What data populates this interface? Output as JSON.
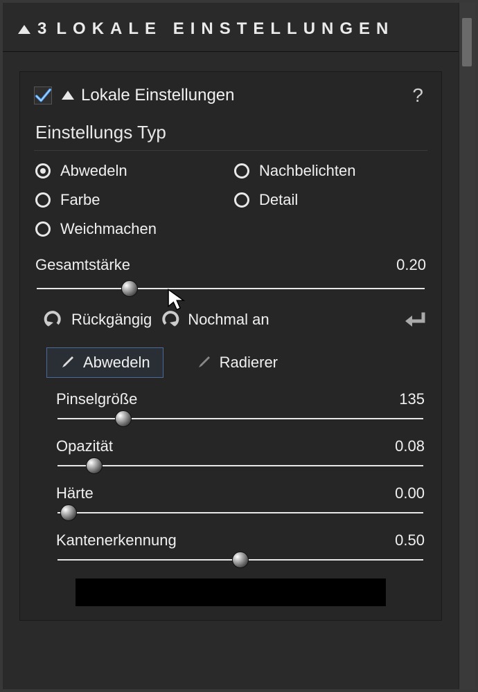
{
  "header": {
    "number": "3",
    "title": "LOKALE EINSTELLUNGEN"
  },
  "panel": {
    "title": "Lokale Einstellungen",
    "help": "?",
    "subheading": "Einstellungs Typ",
    "radios": {
      "dodge": "Abwedeln",
      "burn": "Nachbelichten",
      "color": "Farbe",
      "detail": "Detail",
      "blur": "Weichmachen"
    },
    "overall": {
      "label": "Gesamtstärke",
      "value": "0.20",
      "pos": 24
    },
    "actions": {
      "undo": "Rückgängig",
      "redo": "Nochmal an"
    },
    "tools": {
      "dodge": "Abwedeln",
      "eraser": "Radierer"
    },
    "sliders": {
      "brush": {
        "label": "Pinselgröße",
        "value": "135",
        "pos": 18
      },
      "opacity": {
        "label": "Opazität",
        "value": "0.08",
        "pos": 10
      },
      "hardness": {
        "label": "Härte",
        "value": "0.00",
        "pos": 3
      },
      "edge": {
        "label": "Kantenerkennung",
        "value": "0.50",
        "pos": 50
      }
    }
  }
}
